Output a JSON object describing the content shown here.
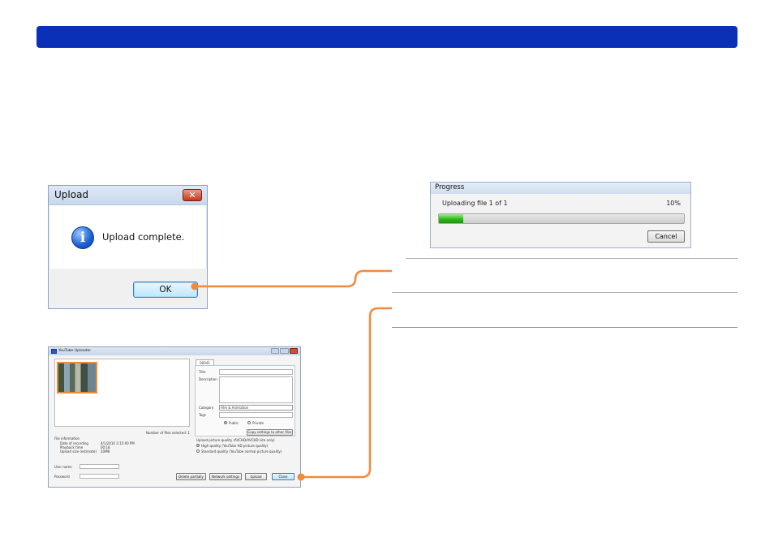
{
  "upload_dialog": {
    "title": "Upload",
    "close_glyph": "✕",
    "message": "Upload complete.",
    "icon": "info-icon",
    "ok_label": "OK"
  },
  "progress_window": {
    "title": "Progress",
    "status": "Uploading file 1 of 1",
    "percent_text": "10%",
    "progress_fraction": 0.1,
    "cancel_label": "Cancel",
    "fill_color": "#2fb81a"
  },
  "youtube_uploader": {
    "title": "YouTube Uploader",
    "files_selected": "Number of files selected: 1",
    "file_info": {
      "heading": "File information",
      "rows": [
        {
          "label": "Date of recording",
          "value": "4/1/2010 2:15:00 PM"
        },
        {
          "label": "Playback time",
          "value": "00:18"
        },
        {
          "label": "Upload size (estimate)",
          "value": "20MB"
        }
      ]
    },
    "user_name_label": "User name",
    "password_label": "Password",
    "tab_label": "00041",
    "title_label": "Title",
    "description_label": "Description",
    "category_label": "Category",
    "category_value": "Film & Animation",
    "tags_label": "Tags",
    "public_label": "Public",
    "private_label": "Private",
    "apply_other_label": "Copy settings to other files",
    "quality_heading": "Upload picture quality (AVCHD/AVCHD Lite only)",
    "quality_options": [
      "High quality (YouTube HD picture quality)",
      "Standard quality (YouTube normal picture quality)"
    ],
    "buttons": {
      "delete_partially": "Delete partially",
      "network_settings": "Network settings",
      "upload": "Upload",
      "close": "Close"
    }
  },
  "colors": {
    "header_bar": "#0a30b8",
    "connector": "#f08a3c"
  }
}
